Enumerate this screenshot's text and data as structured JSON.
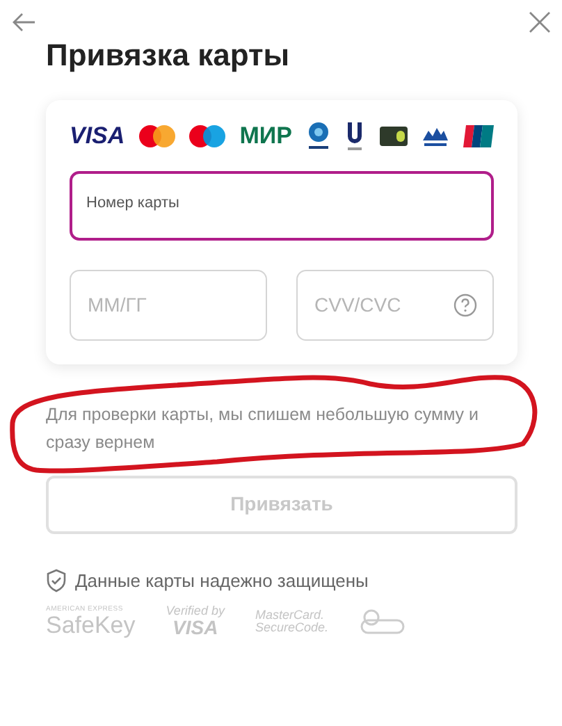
{
  "title": "Привязка карты",
  "payment_logos": [
    {
      "kind": "visa",
      "text": "VISA"
    },
    {
      "kind": "mastercard"
    },
    {
      "kind": "maestro"
    },
    {
      "kind": "mir",
      "text": "МИР"
    },
    {
      "kind": "belkart"
    },
    {
      "kind": "uzcard"
    },
    {
      "kind": "card"
    },
    {
      "kind": "elcart"
    },
    {
      "kind": "unionpay"
    }
  ],
  "card_number": {
    "label": "Номер карты",
    "focused": true
  },
  "expiry": {
    "placeholder": "ММ/ГГ"
  },
  "cvv": {
    "placeholder": "CVV/CVC"
  },
  "note": "Для проверки карты, мы спишем небольшую сумму и сразу вернем",
  "submit": {
    "label": "Привязать",
    "disabled": true
  },
  "security": "Данные карты надежно защищены",
  "badges": [
    {
      "kind": "safekey",
      "lines": [
        "AMERICAN EXPRESS",
        "SafeKey"
      ]
    },
    {
      "kind": "verified",
      "lines": [
        "Verified by",
        "VISA"
      ]
    },
    {
      "kind": "securecode",
      "lines": [
        "MasterCard.",
        "SecureCode."
      ]
    },
    {
      "kind": "seal"
    }
  ]
}
